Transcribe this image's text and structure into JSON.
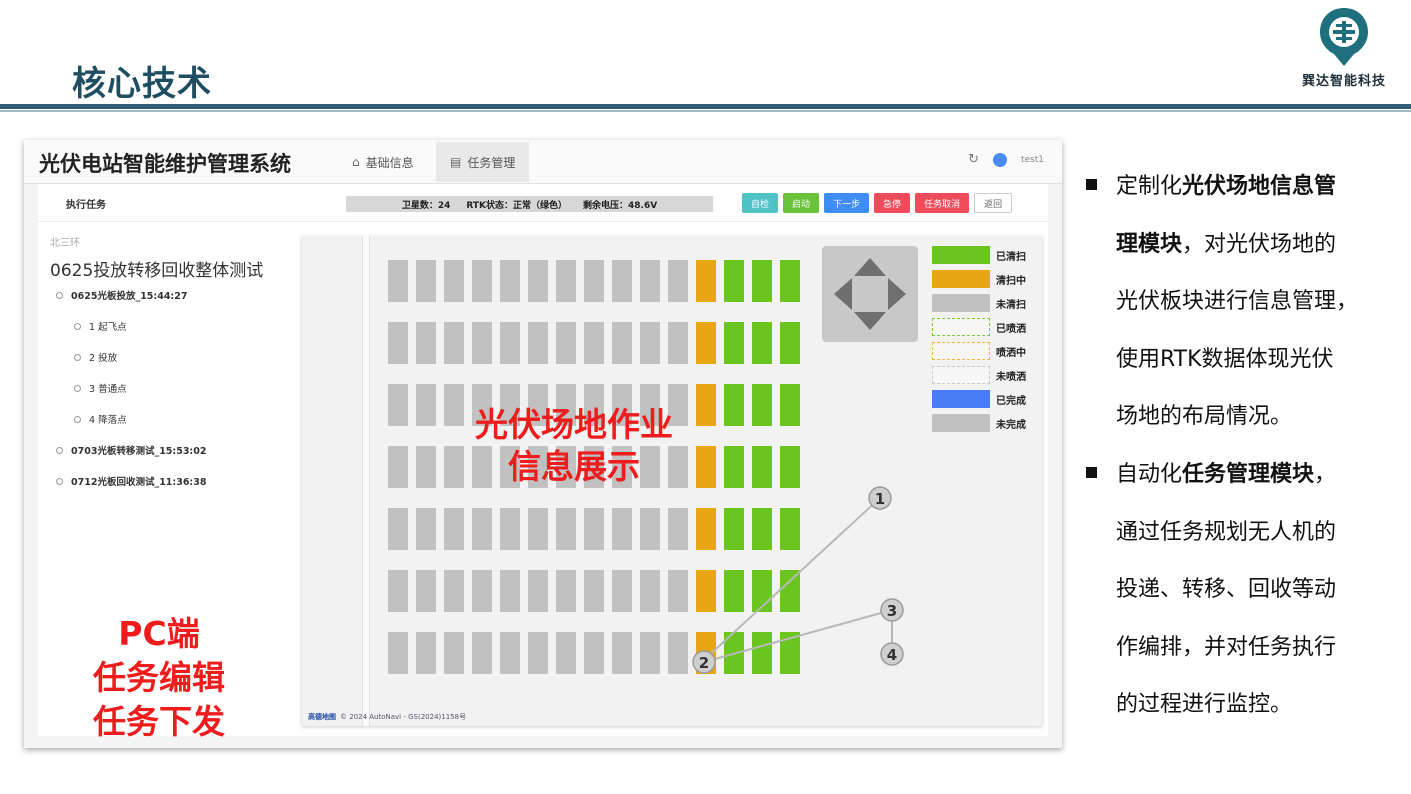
{
  "slide": {
    "title": "核心技术",
    "logo_text": "巽达智能科技"
  },
  "app": {
    "title": "光伏电站智能维护管理系统",
    "nav": [
      {
        "label": "基础信息",
        "icon": "home-icon"
      },
      {
        "label": "任务管理",
        "icon": "document-icon"
      }
    ],
    "user": "test1",
    "toolbar_label": "执行任务",
    "status": {
      "satellites": "卫星数：24",
      "rtk": "RTK状态：正常（绿色）",
      "voltage": "剩余电压：48.6V"
    },
    "buttons": [
      {
        "label": "自检",
        "color": "#4fc3c3"
      },
      {
        "label": "启动",
        "color": "#6ac23a"
      },
      {
        "label": "下一步",
        "color": "#3d8df2"
      },
      {
        "label": "急停",
        "color": "#ee4b5b"
      },
      {
        "label": "任务取消",
        "color": "#ee4b5b"
      },
      {
        "label": "返回",
        "color": "#ffffff"
      }
    ],
    "location": "北三环",
    "task_title": "0625投放转移回收整体测试",
    "tasks": [
      {
        "label": "0625光板投放_15:44:27",
        "steps": [
          "1  起飞点",
          "2  投放",
          "3  普通点",
          "4  降落点"
        ]
      },
      {
        "label": "0703光板转移测试_15:53:02",
        "steps": []
      },
      {
        "label": "0712光板回收测试_11:36:38",
        "steps": []
      }
    ],
    "pc_label": [
      "PC端",
      "任务编辑",
      "任务下发"
    ],
    "map_overlay": [
      "光伏场地作业",
      "信息展示"
    ],
    "legend": [
      {
        "label": "已清扫",
        "style": "solid",
        "color": "#6ac61f"
      },
      {
        "label": "清扫中",
        "style": "solid",
        "color": "#e8a612"
      },
      {
        "label": "未清扫",
        "style": "solid",
        "color": "#c1c1c1"
      },
      {
        "label": "已喷洒",
        "style": "dashed",
        "color": "#7ccc3a"
      },
      {
        "label": "喷洒中",
        "style": "dashed",
        "color": "#f0b43a"
      },
      {
        "label": "未喷洒",
        "style": "dashed",
        "color": "#c9c9c9"
      },
      {
        "label": "已完成",
        "style": "solid",
        "color": "#4a7cf5"
      },
      {
        "label": "未完成",
        "style": "solid",
        "color": "#c1c1c1"
      }
    ],
    "grid": {
      "rows": 7,
      "gray_cols": 11,
      "active_col": "orange",
      "green_cols": 3
    },
    "callouts": [
      "1",
      "2",
      "3",
      "4"
    ],
    "map_footer": {
      "brand": "高德地图",
      "copyright": "© 2024 AutoNavi - GS(2024)1158号"
    }
  },
  "description": [
    {
      "lines": [
        [
          "",
          "定制化"
        ],
        [
          "b",
          "光伏场地信息管"
        ]
      ],
      "rest": [
        [
          [
            "b",
            "理模块"
          ],
          [
            "",
            "，对光伏场地的"
          ]
        ],
        [
          [
            "",
            "光伏板块进行信息管理，"
          ]
        ],
        [
          [
            "",
            "使用RTK数据体现光伏"
          ]
        ],
        [
          [
            "",
            "场地的布局情况。"
          ]
        ]
      ]
    },
    {
      "lines": [
        [
          "",
          "自动化"
        ],
        [
          "b",
          "任务管理模块"
        ],
        [
          "",
          "，"
        ]
      ],
      "rest": [
        [
          [
            "",
            "通过任务规划无人机的"
          ]
        ],
        [
          [
            "",
            "投递、转移、回收等动"
          ]
        ],
        [
          [
            "",
            "作编排，并对任务执行"
          ]
        ],
        [
          [
            "",
            "的过程进行监控。"
          ]
        ]
      ]
    }
  ]
}
